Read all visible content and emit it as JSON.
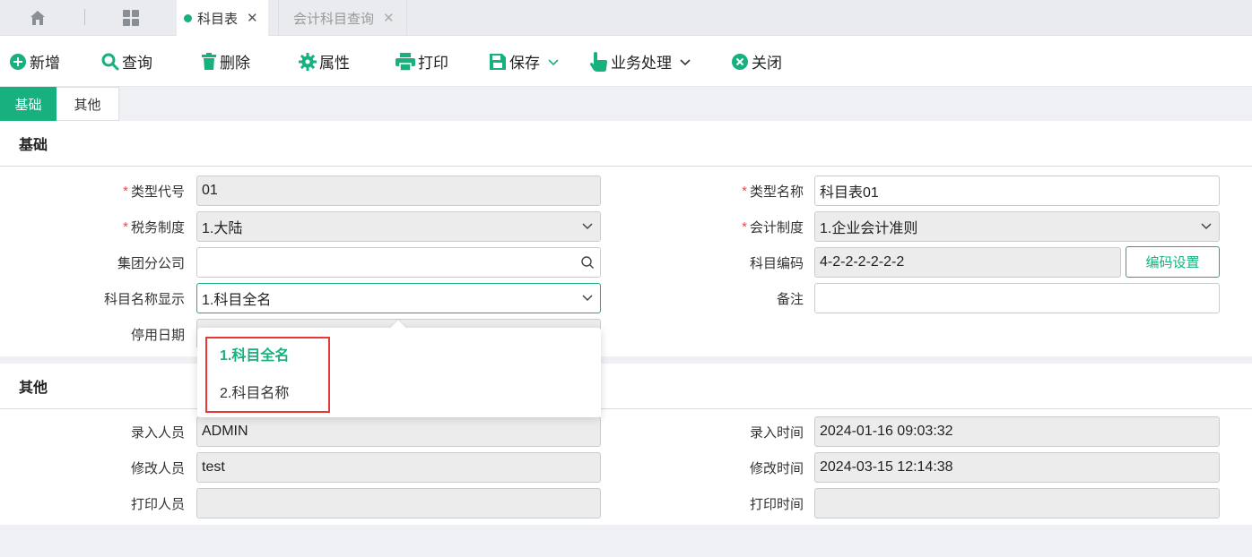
{
  "tabs": [
    {
      "label": "科目表",
      "active": true
    },
    {
      "label": "会计科目查询",
      "active": false
    }
  ],
  "toolbar": {
    "add": "新增",
    "query": "查询",
    "delete": "删除",
    "props": "属性",
    "print": "打印",
    "save": "保存",
    "business": "业务处理",
    "close": "关闭"
  },
  "subtabs": [
    "基础",
    "其他"
  ],
  "basic": {
    "title": "基础",
    "type_code_label": "类型代号",
    "type_code_value": "01",
    "type_name_label": "类型名称",
    "type_name_value": "科目表01",
    "tax_label": "税务制度",
    "tax_value": "1.大陆",
    "acct_label": "会计制度",
    "acct_value": "1.企业会计准则",
    "branch_label": "集团分公司",
    "branch_value": "",
    "code_label": "科目编码",
    "code_value": "4-2-2-2-2-2-2",
    "code_button": "编码设置",
    "display_label": "科目名称显示",
    "display_value": "1.科目全名",
    "remark_label": "备注",
    "remark_value": "",
    "stop_label": "停用日期"
  },
  "dropdown": {
    "options": [
      "1.科目全名",
      "2.科目名称"
    ],
    "selected": "1.科目全名"
  },
  "other": {
    "title": "其他",
    "entry_user_label": "录入人员",
    "entry_user_value": "ADMIN",
    "entry_time_label": "录入时间",
    "entry_time_value": "2024-01-16 09:03:32",
    "mod_user_label": "修改人员",
    "mod_user_value": "test",
    "mod_time_label": "修改时间",
    "mod_time_value": "2024-03-15 12:14:38",
    "print_user_label": "打印人员",
    "print_user_value": "",
    "print_time_label": "打印时间",
    "print_time_value": ""
  },
  "colors": {
    "accent": "#17b07f",
    "required": "#e64b4b",
    "highlight": "#e53935"
  }
}
